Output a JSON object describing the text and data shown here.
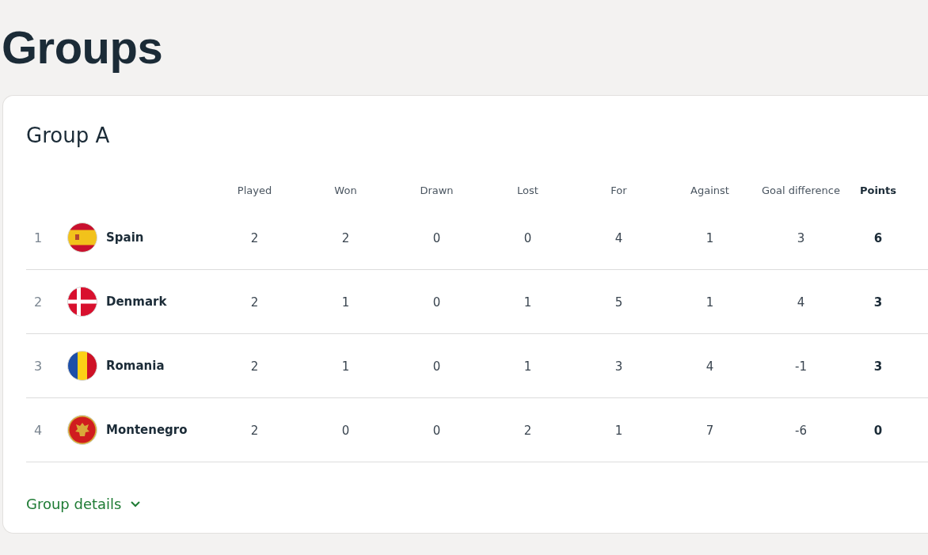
{
  "page_title": "Groups",
  "group": {
    "title": "Group A",
    "columns": [
      {
        "label": "Played",
        "bold": false
      },
      {
        "label": "Won",
        "bold": false
      },
      {
        "label": "Drawn",
        "bold": false
      },
      {
        "label": "Lost",
        "bold": false
      },
      {
        "label": "For",
        "bold": false
      },
      {
        "label": "Against",
        "bold": false
      },
      {
        "label": "Goal difference",
        "bold": false
      },
      {
        "label": "Points",
        "bold": true
      }
    ],
    "rows": [
      {
        "rank": "1",
        "team": "Spain",
        "kind": "spain",
        "stats": [
          "2",
          "2",
          "0",
          "0",
          "4",
          "1",
          "3",
          "6"
        ]
      },
      {
        "rank": "2",
        "team": "Denmark",
        "kind": "denmark",
        "stats": [
          "2",
          "1",
          "0",
          "1",
          "5",
          "1",
          "4",
          "3"
        ]
      },
      {
        "rank": "3",
        "team": "Romania",
        "kind": "romania",
        "stats": [
          "2",
          "1",
          "0",
          "1",
          "3",
          "4",
          "-1",
          "3"
        ]
      },
      {
        "rank": "4",
        "team": "Montenegro",
        "kind": "montenegro",
        "stats": [
          "2",
          "0",
          "0",
          "2",
          "1",
          "7",
          "-6",
          "0"
        ]
      }
    ],
    "details_link": "Group details"
  }
}
